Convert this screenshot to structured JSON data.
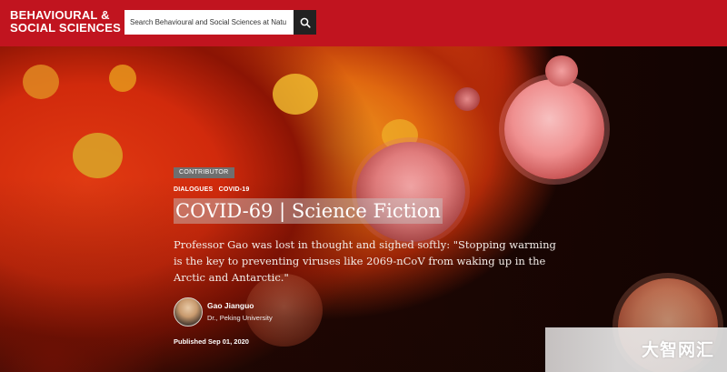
{
  "header": {
    "logo_line1": "BEHAVIOURAL &",
    "logo_line2": "SOCIAL SCIENCES",
    "search_placeholder": "Search Behavioural and Social Sciences at Natu",
    "search_icon": "search-icon",
    "brand_color": "#c1141f"
  },
  "article": {
    "badge": "CONTRIBUTOR",
    "tags": [
      "DIALOGUES",
      "COVID-19"
    ],
    "title": "COVID-69 | Science Fiction",
    "description": "Professor Gao was lost in thought and sighed softly: \"Stopping warming is the key to preventing viruses like 2069-nCoV from waking up in the Arctic and Antarctic.\"",
    "author": {
      "name": "Gao Jianguo",
      "affiliation": "Dr., Peking University"
    },
    "published": "Published Sep 01, 2020"
  },
  "watermark": {
    "text": "大智网汇"
  }
}
